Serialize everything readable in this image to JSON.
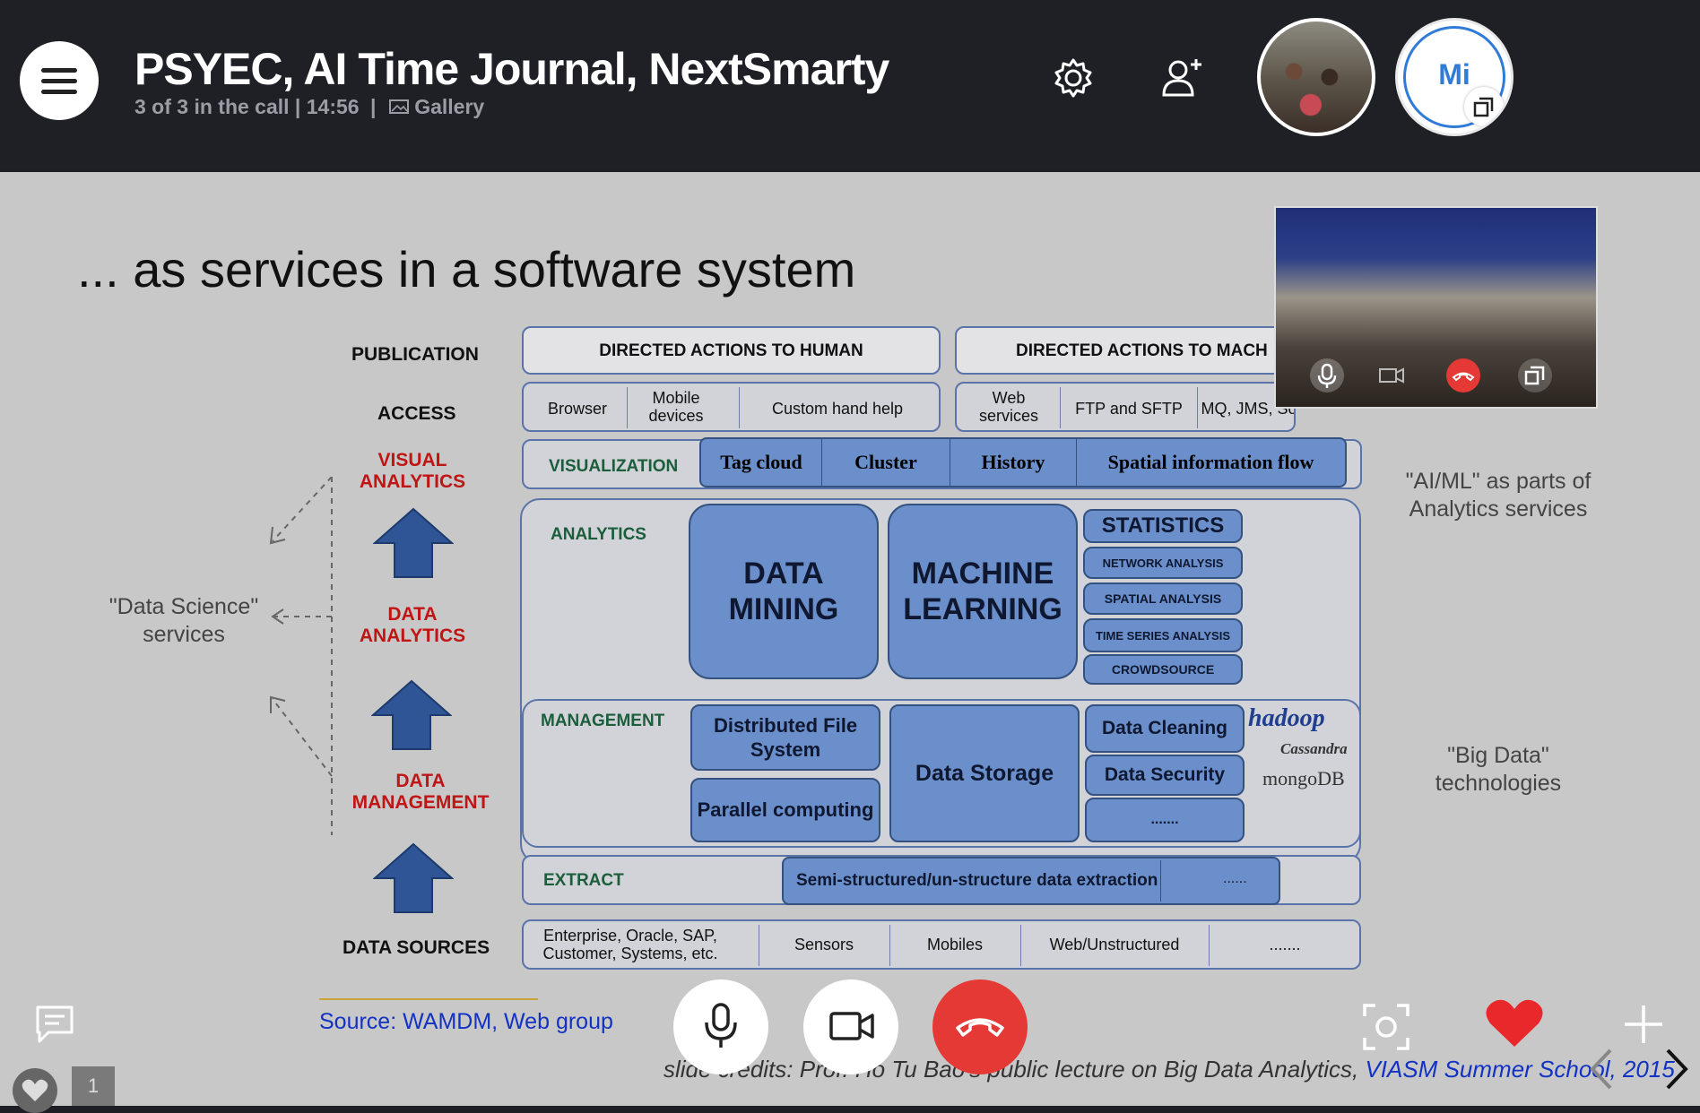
{
  "call": {
    "title": "PSYEC, AI Time Journal, NextSmarty",
    "status": "3 of 3 in the call | 14:56",
    "separator": "|",
    "view_mode": "Gallery",
    "participant_initials": "Mi"
  },
  "icons": [
    "menu-icon",
    "gallery-icon",
    "gear-icon",
    "add-person-icon",
    "popout-icon",
    "chat-icon",
    "heart-icon",
    "microphone-icon",
    "camera-icon",
    "hang-up-icon",
    "snapshot-icon",
    "plus-icon",
    "chevron-left-icon",
    "chevron-right-icon"
  ],
  "colors": {
    "topbar": "#1e2026",
    "hangup": "#e53935",
    "heart": "#e8282b",
    "link": "#1232c4",
    "diagram_blue": "#6a8fca"
  },
  "reactions": {
    "count": "1"
  },
  "slide": {
    "title": "... as services in a software system",
    "rows": {
      "publication": "PUBLICATION",
      "access": "ACCESS",
      "visual_analytics": "VISUAL ANALYTICS",
      "data_analytics": "DATA ANALYTICS",
      "data_management": "DATA MANAGEMENT",
      "data_sources": "DATA SOURCES"
    },
    "publication": {
      "human": "DIRECTED ACTIONS TO HUMAN",
      "machine": "DIRECTED ACTIONS TO MACH"
    },
    "access": {
      "browser": "Browser",
      "mobile": "Mobile devices",
      "custom": "Custom hand help",
      "web": "Web services",
      "ftp": "FTP and SFTP",
      "mq": "MQ, JMS, Sockets"
    },
    "visualization": {
      "label": "VISUALIZATION",
      "items": [
        "Tag cloud",
        "Cluster",
        "History",
        "Spatial information flow"
      ]
    },
    "analytics": {
      "label": "ANALYTICS",
      "data_mining": "DATA MINING",
      "machine_learning": "MACHINE LEARNING",
      "statistics": "STATISTICS",
      "stats_items": [
        "NETWORK ANALYSIS",
        "SPATIAL ANALYSIS",
        "TIME SERIES ANALYSIS",
        "CROWDSOURCE"
      ]
    },
    "management": {
      "label": "MANAGEMENT",
      "dfs": "Distributed File System",
      "parallel": "Parallel computing",
      "storage": "Data Storage",
      "cleaning": "Data Cleaning",
      "security": "Data Security",
      "more": ".......",
      "logos": [
        "hadoop",
        "Cassandra",
        "mongoDB"
      ]
    },
    "extract": {
      "label": "EXTRACT",
      "item": "Semi-structured/un-structure data extraction",
      "more": "......"
    },
    "sources": {
      "items": [
        "Enterprise, Oracle, SAP, Customer, Systems, etc.",
        "Sensors",
        "Mobiles",
        "Web/Unstructured",
        "......."
      ]
    },
    "notes": {
      "data_science": "\"Data Science\" services",
      "aiml": "\"AI/ML\" as parts of Analytics services",
      "big_data": "\"Big Data\" technologies"
    },
    "source": "Source: WAMDM, Web group",
    "credits_prefix": "slide credits: Prof. Ho Tu Bao's public lecture on Big Data Analytics,",
    "credits_link": "VIASM Summer School, 2015"
  }
}
